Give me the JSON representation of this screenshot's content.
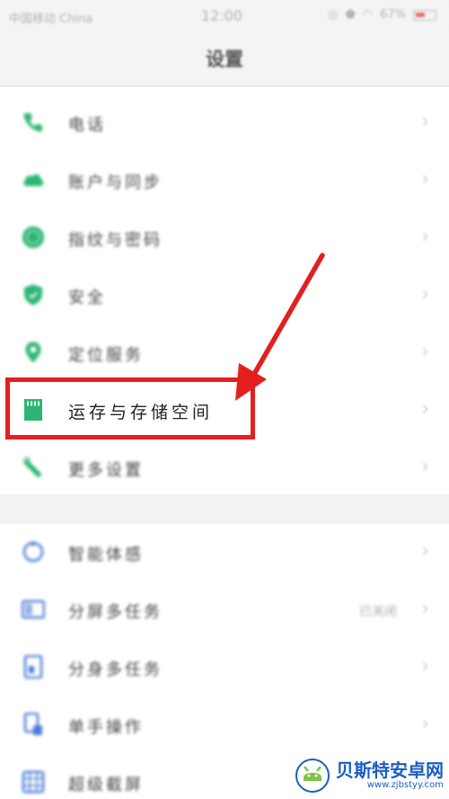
{
  "status_bar": {
    "carrier": "中国移动 China",
    "time": "12:00",
    "battery": "67%"
  },
  "header": {
    "title": "设置"
  },
  "group1": [
    {
      "label": "电话",
      "icon": "phone-icon",
      "color": "#2bb673"
    },
    {
      "label": "账户与同步",
      "icon": "cloud-icon",
      "color": "#2bb673"
    },
    {
      "label": "指纹与密码",
      "icon": "fingerprint-icon",
      "color": "#2bb673"
    },
    {
      "label": "安全",
      "icon": "shield-icon",
      "color": "#2bb673"
    },
    {
      "label": "定位服务",
      "icon": "location-pin-icon",
      "color": "#2bb673"
    },
    {
      "label": "运存与存储空间",
      "icon": "sd-card-icon",
      "color": "#2bb673"
    },
    {
      "label": "更多设置",
      "icon": "wrench-icon",
      "color": "#2bb673"
    }
  ],
  "group2": [
    {
      "label": "智能体感",
      "icon": "motion-icon",
      "color": "#4a7bd6"
    },
    {
      "label": "分屏多任务",
      "icon": "split-screen-icon",
      "color": "#4a7bd6",
      "value": "已关闭"
    },
    {
      "label": "分身多任务",
      "icon": "clone-app-icon",
      "color": "#4a7bd6"
    },
    {
      "label": "单手操作",
      "icon": "one-hand-icon",
      "color": "#4a7bd6"
    },
    {
      "label": "超级截屏",
      "icon": "screenshot-icon",
      "color": "#4a7bd6"
    }
  ],
  "chevron": "›",
  "highlight_color": "#e41f1f",
  "watermark": {
    "title": "贝斯特安卓网",
    "url": "www.zjbstyy.com"
  }
}
